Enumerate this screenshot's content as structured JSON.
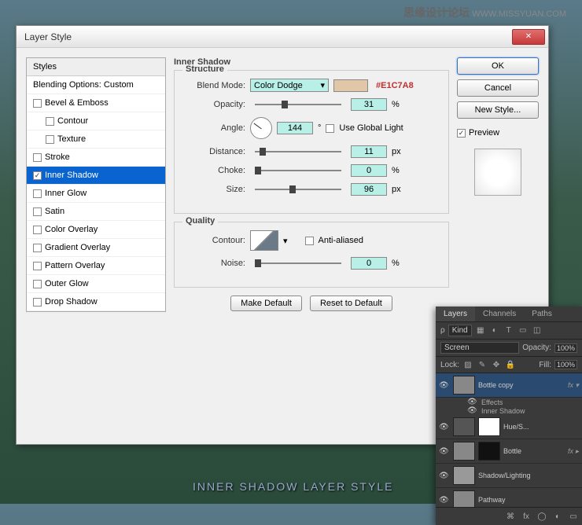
{
  "watermark": {
    "cn": "思缘设计论坛",
    "en": "WWW.MISSYUAN.COM"
  },
  "caption": "INNER SHADOW LAYER STYLE",
  "dialog": {
    "title": "Layer Style",
    "styles_header": "Styles",
    "blending_options": "Blending Options: Custom",
    "items": [
      {
        "label": "Bevel & Emboss",
        "checked": false,
        "sub": false
      },
      {
        "label": "Contour",
        "checked": false,
        "sub": true
      },
      {
        "label": "Texture",
        "checked": false,
        "sub": true
      },
      {
        "label": "Stroke",
        "checked": false,
        "sub": false
      },
      {
        "label": "Inner Shadow",
        "checked": true,
        "sub": false,
        "selected": true
      },
      {
        "label": "Inner Glow",
        "checked": false,
        "sub": false
      },
      {
        "label": "Satin",
        "checked": false,
        "sub": false
      },
      {
        "label": "Color Overlay",
        "checked": false,
        "sub": false
      },
      {
        "label": "Gradient Overlay",
        "checked": false,
        "sub": false
      },
      {
        "label": "Pattern Overlay",
        "checked": false,
        "sub": false
      },
      {
        "label": "Outer Glow",
        "checked": false,
        "sub": false
      },
      {
        "label": "Drop Shadow",
        "checked": false,
        "sub": false
      }
    ],
    "panel_title": "Inner Shadow",
    "structure": {
      "title": "Structure",
      "blend_mode_label": "Blend Mode:",
      "blend_mode": "Color Dodge",
      "color_hex": "#E1C7A8",
      "opacity_label": "Opacity:",
      "opacity": "31",
      "angle_label": "Angle:",
      "angle": "144",
      "deg": "°",
      "use_global": "Use Global Light",
      "distance_label": "Distance:",
      "distance": "11",
      "choke_label": "Choke:",
      "choke": "0",
      "size_label": "Size:",
      "size": "96",
      "pct": "%",
      "px": "px"
    },
    "quality": {
      "title": "Quality",
      "contour_label": "Contour:",
      "antialias": "Anti-aliased",
      "noise_label": "Noise:",
      "noise": "0",
      "pct": "%"
    },
    "make_default": "Make Default",
    "reset_default": "Reset to Default",
    "ok": "OK",
    "cancel": "Cancel",
    "new_style": "New Style...",
    "preview": "Preview"
  },
  "layers": {
    "tabs": [
      "Layers",
      "Channels",
      "Paths"
    ],
    "kind": "Kind",
    "blend": "Screen",
    "opacity_label": "Opacity:",
    "opacity": "100%",
    "lock_label": "Lock:",
    "fill_label": "Fill:",
    "fill": "100%",
    "items": [
      {
        "name": "Bottle copy",
        "fx": true,
        "selected": true
      },
      {
        "name": "Effects",
        "sub": true
      },
      {
        "name": "Inner Shadow",
        "sub": true
      },
      {
        "name": "Hue/S...",
        "adj": true
      },
      {
        "name": "Bottle",
        "fx": true
      },
      {
        "name": "Shadow/Lighting"
      },
      {
        "name": "Pathway"
      }
    ]
  }
}
